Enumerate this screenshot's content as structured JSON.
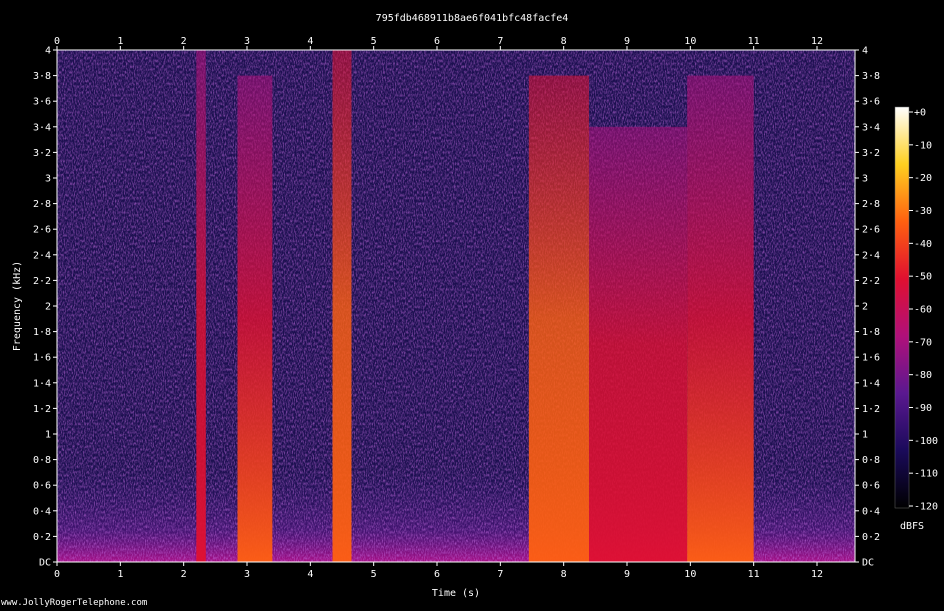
{
  "chart_data": {
    "type": "heatmap",
    "title": "795fdb468911b8ae6f041bfc48facfe4",
    "xlabel": "Time (s)",
    "ylabel": "Frequency (kHz)",
    "xlim": [
      0,
      12.6
    ],
    "ylim": [
      0,
      4
    ],
    "x_ticks": [
      "0",
      "1",
      "2",
      "3",
      "4",
      "5",
      "6",
      "7",
      "8",
      "9",
      "10",
      "11",
      "12"
    ],
    "y_ticks": [
      "DC",
      "0·2",
      "0·4",
      "0·6",
      "0·8",
      "1",
      "1·2",
      "1·4",
      "1·6",
      "1·8",
      "2",
      "2·2",
      "2·4",
      "2·6",
      "2·8",
      "3",
      "3·2",
      "3·4",
      "3·6",
      "3·8",
      "4"
    ],
    "colorbar": {
      "label": "dBFS",
      "ticks": [
        "+0",
        "-10",
        "-20",
        "-30",
        "-40",
        "-50",
        "-60",
        "-70",
        "-80",
        "-90",
        "-100",
        "-110",
        "-120"
      ],
      "range": [
        -120,
        0
      ],
      "colors": [
        "#000000",
        "#1a0a5a",
        "#5a1890",
        "#b0107a",
        "#e01030",
        "#ff6010",
        "#ffd020",
        "#ffffff"
      ]
    },
    "background_color": "#1c1050",
    "energy_regions": [
      {
        "t_start": 2.2,
        "t_end": 2.35,
        "f_max": 4.0,
        "level": -55
      },
      {
        "t_start": 2.85,
        "t_end": 3.4,
        "f_max": 3.8,
        "level": -45
      },
      {
        "t_start": 4.35,
        "t_end": 4.65,
        "f_max": 4.0,
        "level": -40
      },
      {
        "t_start": 7.45,
        "t_end": 8.4,
        "f_max": 3.8,
        "level": -40
      },
      {
        "t_start": 8.4,
        "t_end": 9.95,
        "f_max": 3.4,
        "level": -55
      },
      {
        "t_start": 9.95,
        "t_end": 11.0,
        "f_max": 3.8,
        "level": -45
      }
    ]
  },
  "footer": {
    "credit": "www.JollyRogerTelephone.com"
  }
}
